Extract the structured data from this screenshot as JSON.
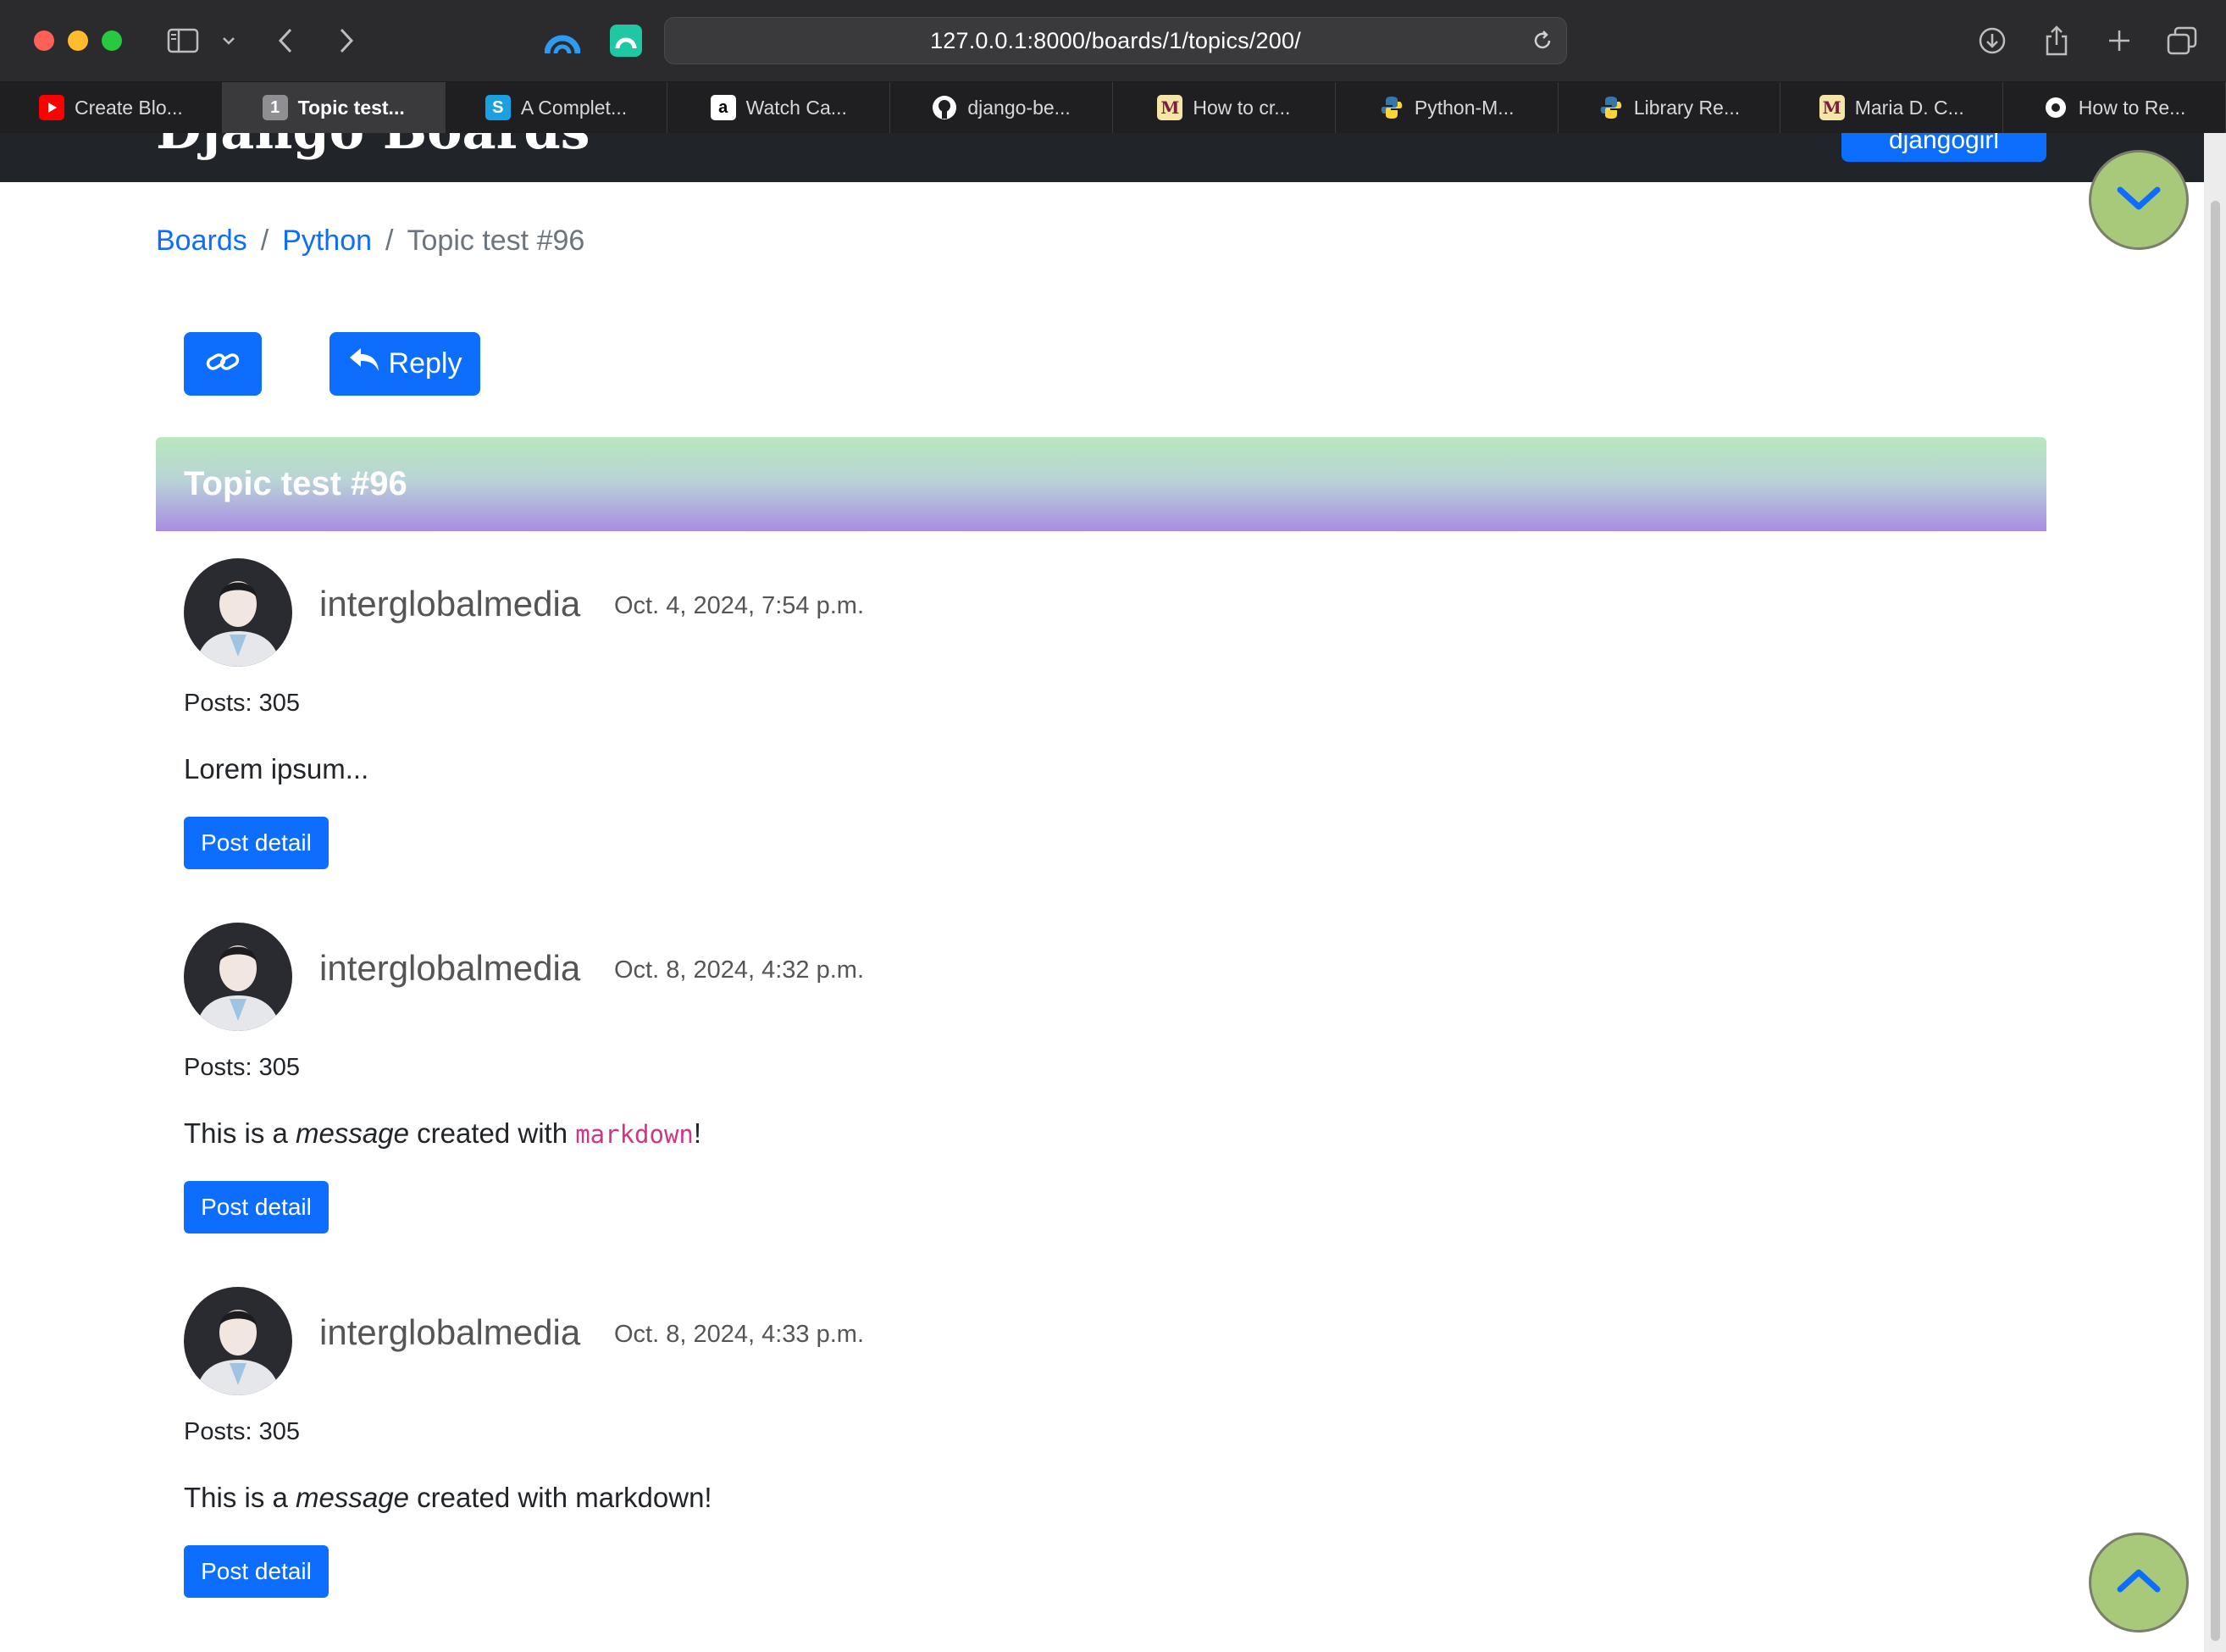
{
  "browser": {
    "url": "127.0.0.1:8000/boards/1/topics/200/",
    "tabs": [
      {
        "label": "Create Blo...",
        "icon": "youtube-icon",
        "color": "#ff0000",
        "active": false
      },
      {
        "label": "Topic test...",
        "icon": "number-one-icon",
        "fav_text": "1",
        "color": "#8e8e93",
        "active": true
      },
      {
        "label": "A Complet...",
        "icon": "s-letter-icon",
        "fav_text": "S",
        "color": "#1ba1e2",
        "active": false
      },
      {
        "label": "Watch Ca...",
        "icon": "amazon-icon",
        "fav_text": "a",
        "color": "#ffffff",
        "active": false
      },
      {
        "label": "django-be...",
        "icon": "github-icon",
        "color": "#ffffff",
        "active": false
      },
      {
        "label": "How to cr...",
        "icon": "medium-m-icon",
        "fav_text": "M",
        "color": "#f5e6a8",
        "active": false
      },
      {
        "label": "Python-M...",
        "icon": "python-icon",
        "color": "#3776ab",
        "active": false
      },
      {
        "label": "Library Re...",
        "icon": "python-icon",
        "color": "#3776ab",
        "active": false
      },
      {
        "label": "Maria D. C...",
        "icon": "medium-m-icon",
        "fav_text": "M",
        "color": "#f5e6a8",
        "active": false
      },
      {
        "label": "How to Re...",
        "icon": "puzzle-icon",
        "color": "#ffffff",
        "active": false
      }
    ]
  },
  "navbar": {
    "brand": "Django Boards",
    "user_button": "djangogirl"
  },
  "breadcrumb": {
    "boards": "Boards",
    "board": "Python",
    "current": "Topic test #96"
  },
  "actions": {
    "reply_label": "Reply"
  },
  "topic": {
    "title": "Topic test #96"
  },
  "posts": [
    {
      "username": "interglobalmedia",
      "date": "Oct. 4, 2024, 7:54 p.m.",
      "posts_count": "Posts: 305",
      "message": "Lorem ipsum...",
      "detail_label": "Post detail"
    },
    {
      "username": "interglobalmedia",
      "date": "Oct. 8, 2024, 4:32 p.m.",
      "posts_count": "Posts: 305",
      "message_parts": [
        "This is a ",
        "message",
        " created with ",
        "markdown",
        "!"
      ],
      "detail_label": "Post detail"
    },
    {
      "username": "interglobalmedia",
      "date": "Oct. 8, 2024, 4:33 p.m.",
      "posts_count": "Posts: 305",
      "message_parts": [
        "This is a ",
        "message",
        " created with markdown!"
      ],
      "detail_label": "Post detail"
    }
  ],
  "colors": {
    "primary": "#0d6efd",
    "navbar": "#212529",
    "header_gradient_top": "#b8e8bd",
    "header_gradient_bottom": "#a98de4",
    "float_button": "#a9c97a",
    "code": "#d63384"
  }
}
